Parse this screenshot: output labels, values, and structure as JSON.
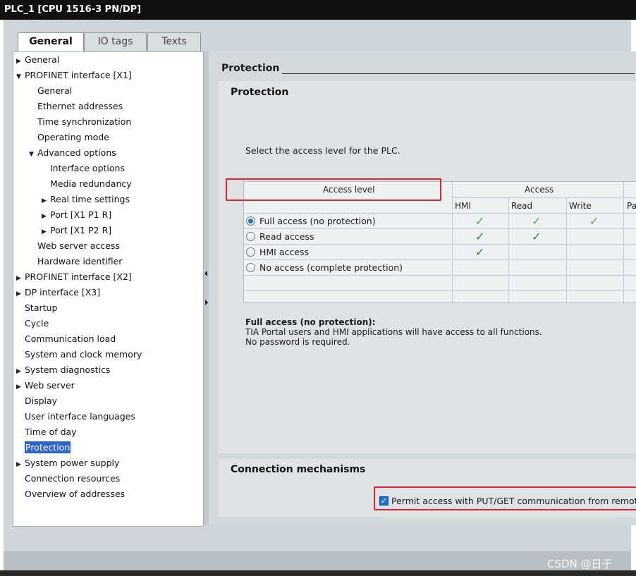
{
  "window": {
    "title": "PLC_1 [CPU 1516-3 PN/DP]"
  },
  "tabs": [
    {
      "label": "General",
      "active": true
    },
    {
      "label": "IO tags",
      "active": false
    },
    {
      "label": "Texts",
      "active": false
    }
  ],
  "nav": {
    "items": [
      {
        "label": "General",
        "expander": "collapsed",
        "selected": false
      },
      {
        "label": "PROFINET interface [X1]",
        "expander": "expanded",
        "selected": false
      },
      {
        "label": "General",
        "expander": "none",
        "selected": false
      },
      {
        "label": "Ethernet addresses",
        "expander": "none",
        "selected": false
      },
      {
        "label": "Time synchronization",
        "expander": "none",
        "selected": false
      },
      {
        "label": "Operating mode",
        "expander": "none",
        "selected": false
      },
      {
        "label": "Advanced options",
        "expander": "expanded",
        "selected": false
      },
      {
        "label": "Interface options",
        "expander": "none",
        "selected": false
      },
      {
        "label": "Media redundancy",
        "expander": "none",
        "selected": false
      },
      {
        "label": "Real time settings",
        "expander": "collapsed",
        "selected": false
      },
      {
        "label": "Port [X1 P1 R]",
        "expander": "collapsed",
        "selected": false
      },
      {
        "label": "Port [X1 P2 R]",
        "expander": "collapsed",
        "selected": false
      },
      {
        "label": "Web server access",
        "expander": "none",
        "selected": false
      },
      {
        "label": "Hardware identifier",
        "expander": "none",
        "selected": false
      },
      {
        "label": "PROFINET interface [X2]",
        "expander": "collapsed",
        "selected": false
      },
      {
        "label": "DP interface [X3]",
        "expander": "collapsed",
        "selected": false
      },
      {
        "label": "Startup",
        "expander": "none",
        "selected": false
      },
      {
        "label": "Cycle",
        "expander": "none",
        "selected": false
      },
      {
        "label": "Communication load",
        "expander": "none",
        "selected": false
      },
      {
        "label": "System and clock memory",
        "expander": "none",
        "selected": false
      },
      {
        "label": "System diagnostics",
        "expander": "collapsed",
        "selected": false
      },
      {
        "label": "Web server",
        "expander": "collapsed",
        "selected": false
      },
      {
        "label": "Display",
        "expander": "none",
        "selected": false
      },
      {
        "label": "User interface languages",
        "expander": "none",
        "selected": false
      },
      {
        "label": "Time of day",
        "expander": "none",
        "selected": false
      },
      {
        "label": "Protection",
        "expander": "none",
        "selected": true
      },
      {
        "label": "System power supply",
        "expander": "collapsed",
        "selected": false
      },
      {
        "label": "Connection resources",
        "expander": "none",
        "selected": false
      },
      {
        "label": "Overview of addresses",
        "expander": "none",
        "selected": false
      }
    ]
  },
  "content": {
    "section_title": "Protection",
    "protection": {
      "title": "Protection",
      "instruction": "Select the access level for the PLC.",
      "table": {
        "header_access_level": "Access level",
        "header_access": "Access",
        "columns": [
          "HMI",
          "Read",
          "Write",
          "Pass"
        ],
        "rows": [
          {
            "label": "Full access (no protection)",
            "selected": true,
            "hmi": true,
            "read": true,
            "write": true
          },
          {
            "label": "Read access",
            "selected": false,
            "hmi": true,
            "read": true,
            "write": false
          },
          {
            "label": "HMI access",
            "selected": false,
            "hmi": true,
            "read": false,
            "write": false
          },
          {
            "label": "No access (complete protection)",
            "selected": false,
            "hmi": false,
            "read": false,
            "write": false
          }
        ]
      },
      "description": {
        "title": "Full access (no protection):",
        "line1": "TIA Portal users and HMI applications will have access to all functions.",
        "line2": "No password is required."
      }
    },
    "connection": {
      "title": "Connection mechanisms",
      "checkbox_label": "Permit access with PUT/GET communication from remot",
      "checked": true
    }
  },
  "watermark": "CSDN @日于",
  "colors": {
    "accent": "#2e63c8",
    "highlight": "#e0262b",
    "check_green": "#1f8f2a"
  }
}
